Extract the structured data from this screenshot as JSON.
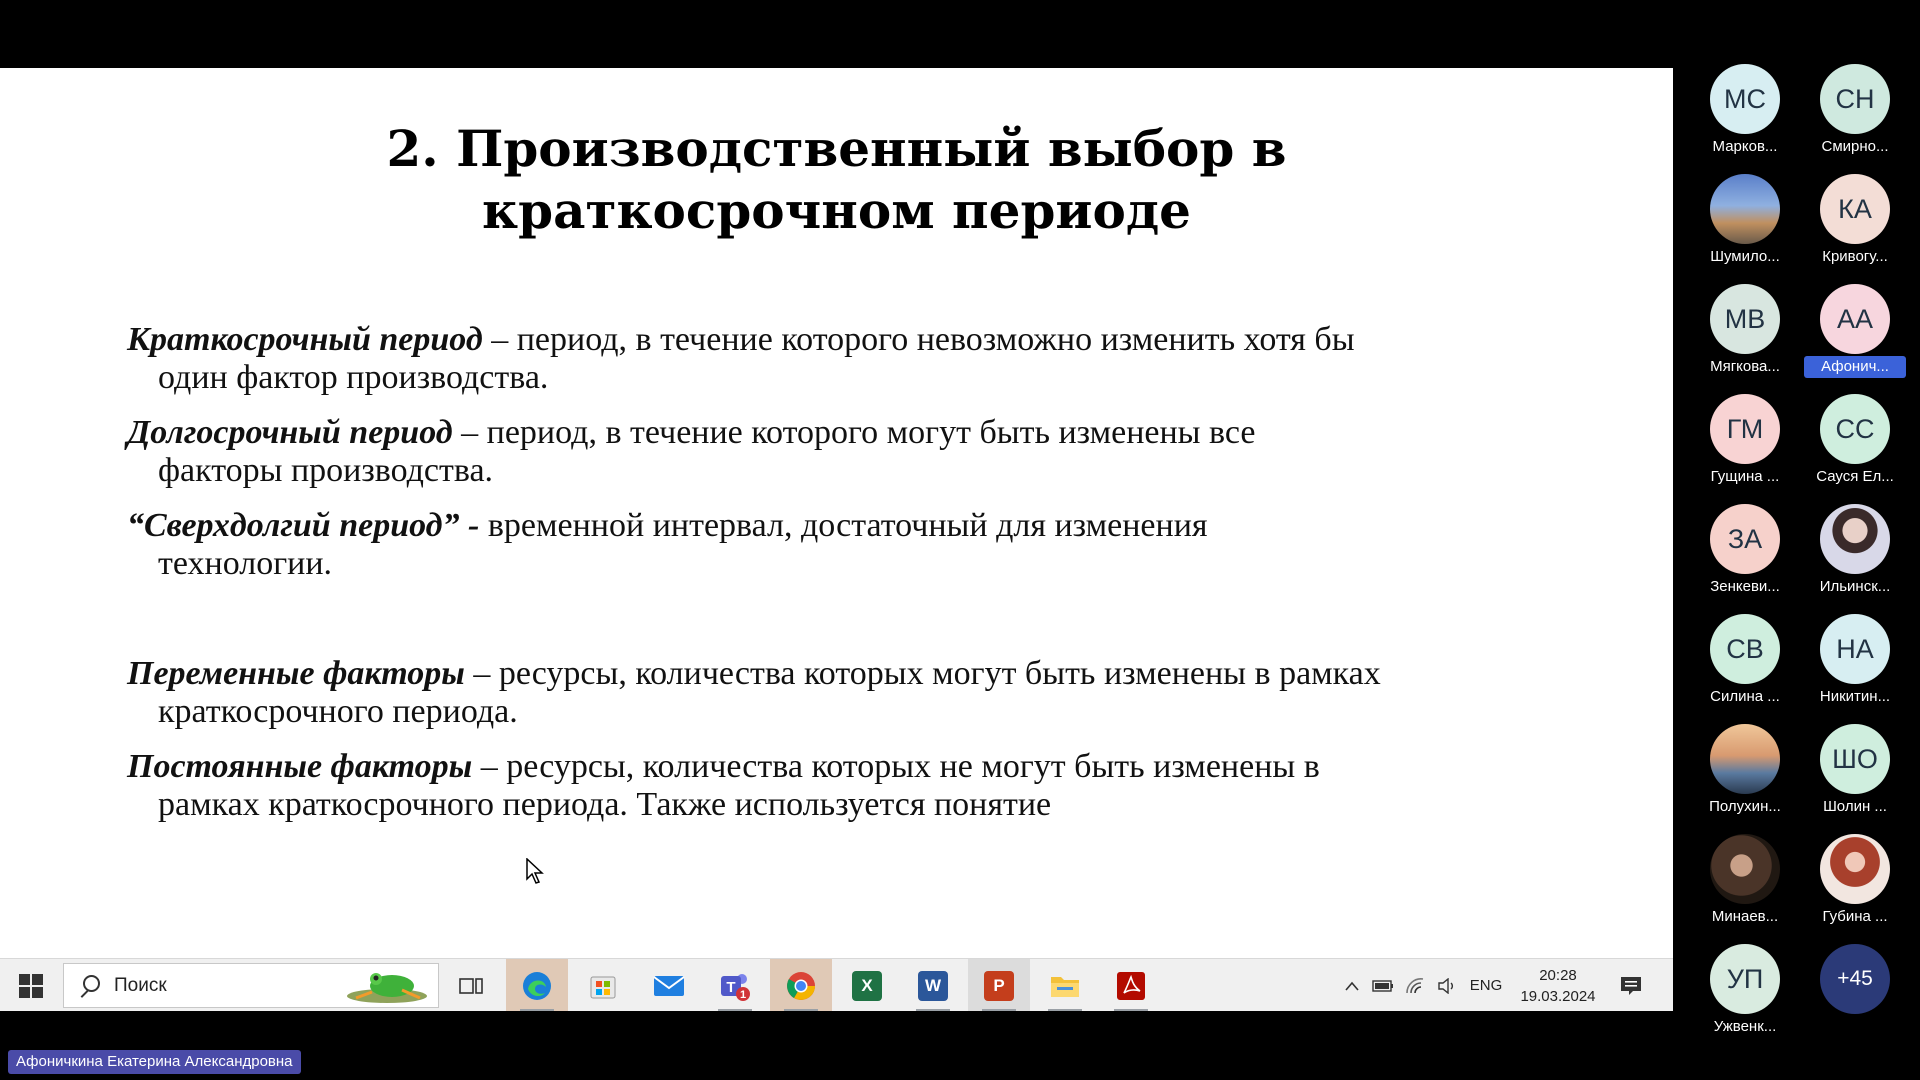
{
  "slide": {
    "title_line1": "2. Производственный выбор в",
    "title_line2": "краткосрочном периоде",
    "definitions": [
      {
        "term": "Краткосрочный период",
        "line1": " – период, в течение которого невозможно изменить хотя бы",
        "line2": "один фактор производства."
      },
      {
        "term": "Долгосрочный период",
        "line1": " – период, в течение которого могут быть изменены все",
        "line2": "факторы производства."
      },
      {
        "term": "“Сверхдолгий период” -",
        "line1": " временной интервал, достаточный для изменения",
        "line2": "технологии."
      },
      {
        "term": "Переменные факторы",
        "line1": " – ресурсы, количества которых могут быть изменены в рамках",
        "line2": "краткосрочного периода."
      },
      {
        "term": "Постоянные факторы",
        "line1": " – ресурсы, количества которых не могут быть изменены в",
        "line2": "рамках краткосрочного периода. Также используется понятие"
      }
    ]
  },
  "taskbar": {
    "search_placeholder": "Поиск",
    "language": "ENG",
    "time": "20:28",
    "date": "19.03.2024",
    "apps": [
      {
        "name": "task-view-icon"
      },
      {
        "name": "edge-icon",
        "color": "#1a7fd8"
      },
      {
        "name": "microsoft-store-icon",
        "color": "#f25022"
      },
      {
        "name": "mail-icon",
        "color": "#1f7fe0"
      },
      {
        "name": "teams-icon",
        "color": "#5059c9",
        "badge": "1"
      },
      {
        "name": "chrome-icon",
        "color": "#db4437"
      },
      {
        "name": "excel-icon",
        "color": "#1f7244",
        "letter": "X"
      },
      {
        "name": "word-icon",
        "color": "#2b579a",
        "letter": "W"
      },
      {
        "name": "powerpoint-icon",
        "color": "#c43e1c",
        "letter": "P"
      },
      {
        "name": "file-explorer-icon",
        "color": "#f3c13a"
      },
      {
        "name": "acrobat-icon",
        "color": "#b30b00"
      }
    ]
  },
  "participants": [
    {
      "initials": "МС",
      "name": "Марков...",
      "bg": "#d7eef2"
    },
    {
      "initials": "СН",
      "name": "Смирно...",
      "bg": "#cfe9df"
    },
    {
      "initials": "",
      "name": "Шумило...",
      "bg": "#7d94b8",
      "photo": true
    },
    {
      "initials": "КА",
      "name": "Кривогу...",
      "bg": "#f3ddd6"
    },
    {
      "initials": "МВ",
      "name": "Мягкова...",
      "bg": "#d8e6e0"
    },
    {
      "initials": "АА",
      "name": "Афонич...",
      "bg": "#f7d6de",
      "highlight": true
    },
    {
      "initials": "ГМ",
      "name": "Гущина ...",
      "bg": "#f8d3d3"
    },
    {
      "initials": "СС",
      "name": "Сауся Ел...",
      "bg": "#cfeede"
    },
    {
      "initials": "ЗА",
      "name": "Зенкеви...",
      "bg": "#f6d1cb"
    },
    {
      "initials": "",
      "name": "Ильинск...",
      "bg": "#b7b0c8",
      "photo": true
    },
    {
      "initials": "СВ",
      "name": "Силина ...",
      "bg": "#cfeede"
    },
    {
      "initials": "НА",
      "name": "Никитин...",
      "bg": "#d7eef2"
    },
    {
      "initials": "",
      "name": "Полухин...",
      "bg": "#c39a78",
      "photo": true
    },
    {
      "initials": "ШО",
      "name": "Шолин ...",
      "bg": "#cfeede"
    },
    {
      "initials": "",
      "name": "Минаев...",
      "bg": "#6b5040",
      "photo": true
    },
    {
      "initials": "",
      "name": "Губина ...",
      "bg": "#e8c7c0",
      "photo": true
    },
    {
      "initials": "УП",
      "name": "Ужвенк...",
      "bg": "#d9ebe0"
    },
    {
      "initials": "+45",
      "name": "",
      "bg": "#2b3a78",
      "more": true
    }
  ],
  "speaker": "Афоничкина Екатерина Александровна"
}
